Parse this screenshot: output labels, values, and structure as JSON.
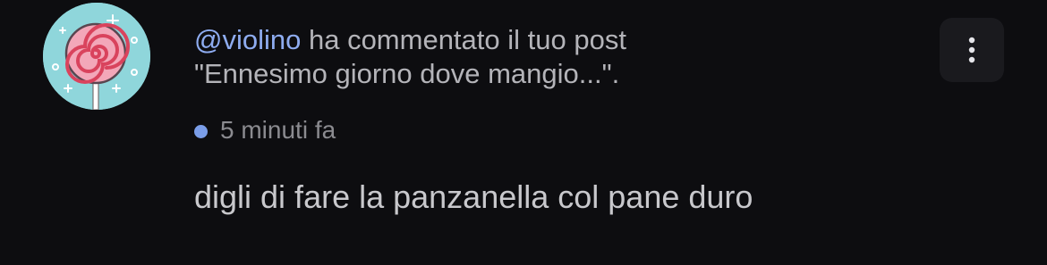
{
  "notification": {
    "avatar_icon": "lollipop-icon",
    "username": "@violino",
    "action_text": " ha commentato il tuo post",
    "post_excerpt": "\"Ennesimo giorno dove mangio...\".",
    "timestamp": "5 minuti fa",
    "comment": "digli di fare la panzanella col pane duro",
    "more_icon": "more-vertical-icon",
    "colors": {
      "background": "#0d0d10",
      "username": "#8eacf0",
      "unread_dot": "#7a9de8",
      "avatar_bg": "#8fd6db"
    }
  }
}
